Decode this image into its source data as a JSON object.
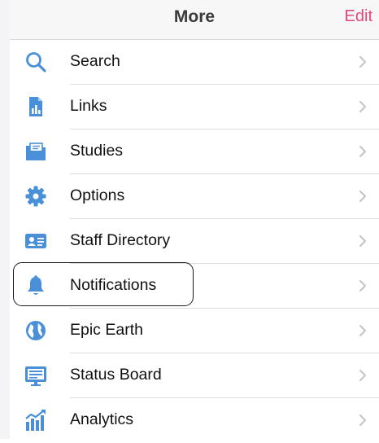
{
  "header": {
    "title": "More",
    "edit_label": "Edit"
  },
  "colors": {
    "accent": "#e6457a",
    "icon_blue": "#4a90d9",
    "chevron": "#c4c4c7"
  },
  "items": [
    {
      "label": "Search",
      "icon": "search-icon"
    },
    {
      "label": "Links",
      "icon": "links-icon"
    },
    {
      "label": "Studies",
      "icon": "studies-icon"
    },
    {
      "label": "Options",
      "icon": "gear-icon"
    },
    {
      "label": "Staff Directory",
      "icon": "staff-card-icon"
    },
    {
      "label": "Notifications",
      "icon": "bell-icon"
    },
    {
      "label": "Epic Earth",
      "icon": "globe-icon"
    },
    {
      "label": "Status Board",
      "icon": "status-board-icon"
    },
    {
      "label": "Analytics",
      "icon": "analytics-icon"
    }
  ]
}
